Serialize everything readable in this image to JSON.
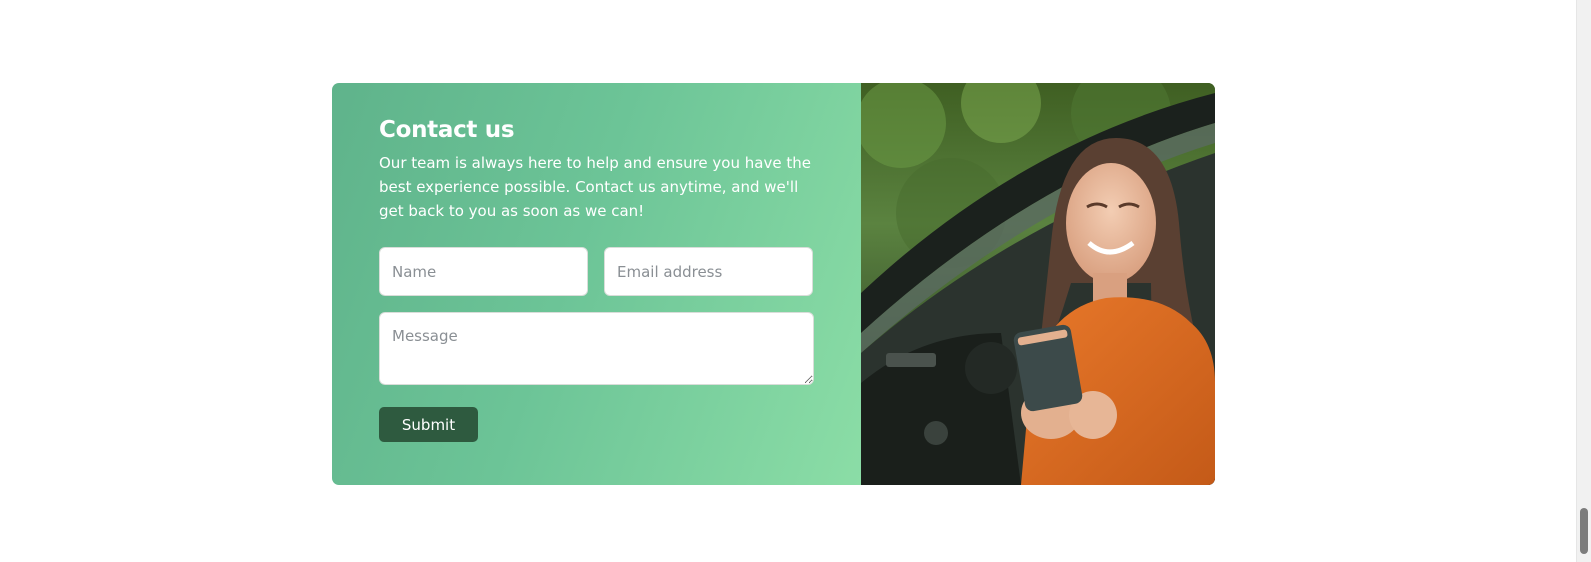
{
  "contact": {
    "title": "Contact us",
    "intro": "Our team is always here to help and ensure you have the best experience possible. Contact us anytime, and we'll get back to you as soon as we can!",
    "name_placeholder": "Name",
    "email_placeholder": "Email address",
    "message_placeholder": "Message",
    "submit_label": "Submit"
  },
  "colors": {
    "gradient_start": "#5fb38b",
    "gradient_end": "#8bdda6",
    "button": "#2e5a3f",
    "text_on_panel": "#ffffff"
  },
  "image": {
    "icon": "photo-woman-in-car-with-phone"
  }
}
